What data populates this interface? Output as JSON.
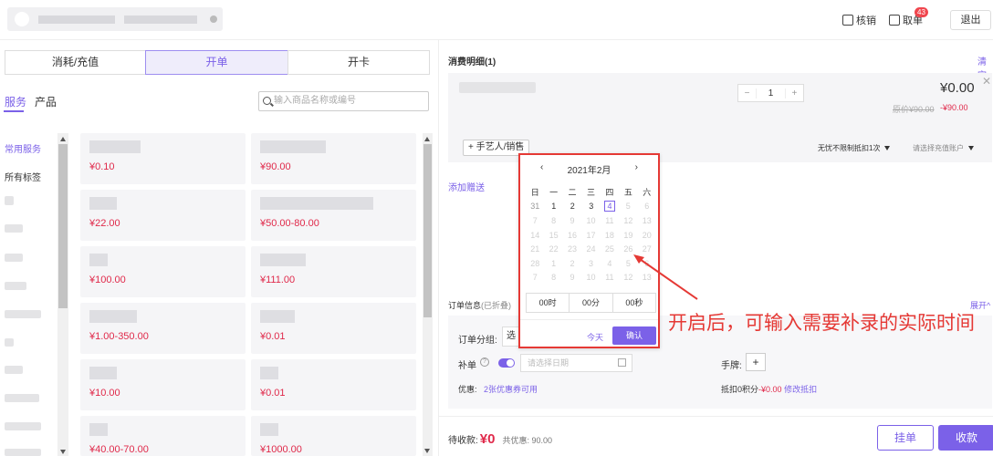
{
  "topbar": {
    "verify_label": "核销",
    "pickup_label": "取单",
    "pickup_badge": "43",
    "logout_label": "退出"
  },
  "left": {
    "tabs": [
      "消耗/充值",
      "开单",
      "开卡"
    ],
    "active_tab": "开单",
    "subtabs": [
      "服务",
      "产品"
    ],
    "search_placeholder": "输入商品名称或编号",
    "categories": [
      "常用服务",
      "所有标签"
    ],
    "products": [
      {
        "price": "¥0.10"
      },
      {
        "price": "¥90.00"
      },
      {
        "price": "¥22.00"
      },
      {
        "price": "¥50.00-80.00"
      },
      {
        "price": "¥100.00"
      },
      {
        "price": "¥111.00"
      },
      {
        "price": "¥1.00-350.00"
      },
      {
        "price": "¥0.01"
      },
      {
        "price": "¥10.00"
      },
      {
        "price": "¥0.01"
      },
      {
        "price": "¥40.00-70.00"
      },
      {
        "price": "¥1000.00"
      }
    ]
  },
  "right": {
    "title": "消费明细(1)",
    "clear_label": "清空",
    "item": {
      "qty": "1",
      "price": "¥0.00",
      "orig_price": "原价¥90.00",
      "discount": "-¥90.00"
    },
    "add_staff": "+ 手艺人/销售",
    "limit_select": "无忧不限制抵扣1次",
    "account_select": "请选择充值账户",
    "add_gift": "添加赠送",
    "order_info": "订单信息",
    "order_info_note": "(已折叠)",
    "expand_label": "展开",
    "order_group_label": "订单分组:",
    "order_group_value": "选",
    "backfill_label": "补单",
    "date_placeholder": "请选择日期",
    "sign_label": "手牌:",
    "coupon_label": "优惠:",
    "coupon_value": "2张优惠券可用",
    "points_text": "抵扣0积分",
    "points_amount": "-¥0.00",
    "points_edit": "修改抵扣",
    "due_label": "待收款:",
    "due_amount": "¥0",
    "saved": "共优惠: 90.00",
    "hold_label": "挂单",
    "pay_label": "收款"
  },
  "calendar": {
    "month_label": "2021年2月",
    "weekdays": [
      "日",
      "一",
      "二",
      "三",
      "四",
      "五",
      "六"
    ],
    "weeks": [
      [
        "31",
        "1",
        "2",
        "3",
        "4",
        "5",
        "6"
      ],
      [
        "7",
        "8",
        "9",
        "10",
        "11",
        "12",
        "13"
      ],
      [
        "14",
        "15",
        "16",
        "17",
        "18",
        "19",
        "20"
      ],
      [
        "21",
        "22",
        "23",
        "24",
        "25",
        "26",
        "27"
      ],
      [
        "28",
        "1",
        "2",
        "3",
        "4",
        "5",
        "6"
      ],
      [
        "7",
        "8",
        "9",
        "10",
        "11",
        "12",
        "13"
      ]
    ],
    "today": "4",
    "hour": "00时",
    "minute": "00分",
    "second": "00秒",
    "today_btn": "今天",
    "confirm_btn": "确认"
  },
  "annotation": "开启后，可输入需要补录的实际时间",
  "colors": {
    "accent": "#7b61e8",
    "price": "#e0294a",
    "annotation": "#e53935"
  }
}
